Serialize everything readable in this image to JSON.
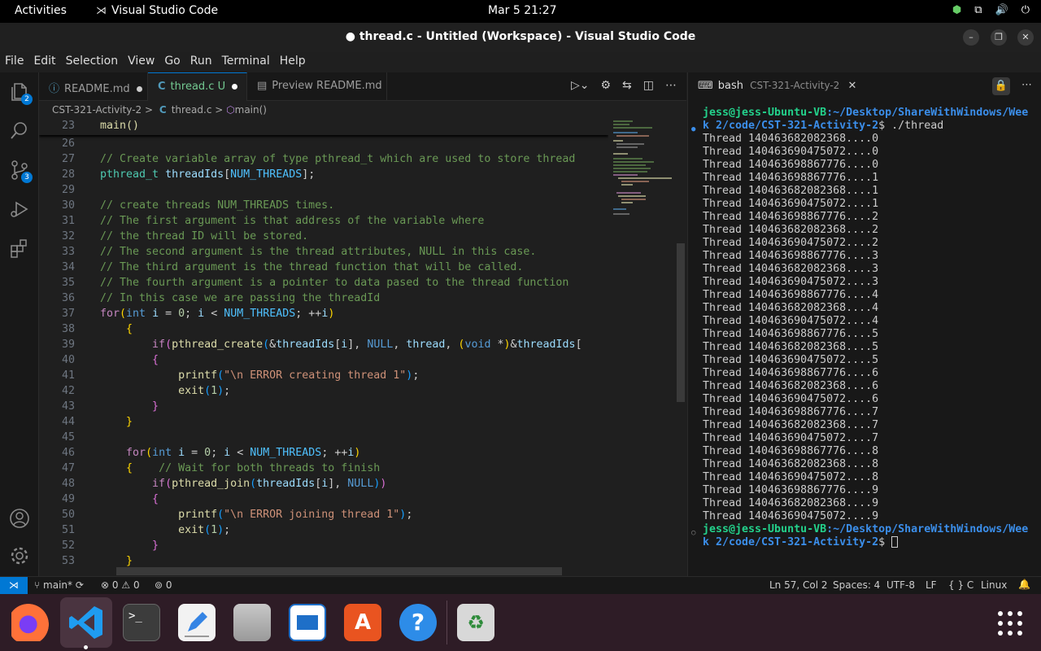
{
  "topbar": {
    "activities": "Activities",
    "app_name": "Visual Studio Code",
    "clock": "Mar 5  21:27"
  },
  "window": {
    "title": "● thread.c - Untitled (Workspace) - Visual Studio Code",
    "min": "–",
    "max": "❐",
    "close": "✕"
  },
  "menu": [
    "File",
    "Edit",
    "Selection",
    "View",
    "Go",
    "Run",
    "Terminal",
    "Help"
  ],
  "activity": {
    "explorer_badge": "2",
    "scm_badge": "3"
  },
  "tabs": [
    {
      "label": "README.md",
      "icon": "ⓘ"
    },
    {
      "label": "thread.c",
      "icon": "C",
      "status": "U"
    },
    {
      "label": "Preview README.md",
      "icon": "▤"
    }
  ],
  "breadcrumb": {
    "folder": "CST-321-Activity-2",
    "sep": ">",
    "file": "thread.c",
    "symbol": "main()",
    "c_icon": "C",
    "sym_icon": "⬡"
  },
  "code": {
    "sticky": {
      "num": "23",
      "text": "main()"
    },
    "lines": [
      {
        "num": "26",
        "html": ""
      },
      {
        "num": "27",
        "html": "<span class='cm'>// Create variable array of type pthread_t which are used to store thread</span>"
      },
      {
        "num": "28",
        "html": "<span class='ty'>pthread_t</span> <span class='vr'>threadIds</span>[<span class='mc'>NUM_THREADS</span>];"
      },
      {
        "num": "29",
        "html": ""
      },
      {
        "num": "30",
        "html": "<span class='cm'>// create threads NUM_THREADS times.</span>"
      },
      {
        "num": "31",
        "html": "<span class='cm'>// The first argument is that address of the variable where</span>"
      },
      {
        "num": "32",
        "html": "<span class='cm'>// the thread ID will be stored.</span>"
      },
      {
        "num": "33",
        "html": "<span class='cm'>// The second argument is the thread attributes, NULL in this case.</span>"
      },
      {
        "num": "34",
        "html": "<span class='cm'>// The third argument is the thread function that will be called.</span>"
      },
      {
        "num": "35",
        "html": "<span class='cm'>// The fourth argument is a pointer to data pased to the thread function</span>"
      },
      {
        "num": "36",
        "html": "<span class='cm'>// In this case we are passing the threadId</span>"
      },
      {
        "num": "37",
        "html": "<span class='ctl'>for</span><span class='br1'>(</span><span class='kw'>int</span> <span class='vr'>i</span> = <span class='nm'>0</span>; <span class='vr'>i</span> &lt; <span class='mc'>NUM_THREADS</span>; ++<span class='vr'>i</span><span class='br1'>)</span>"
      },
      {
        "num": "38",
        "html": "    <span class='br1'>{</span>"
      },
      {
        "num": "39",
        "html": "        <span class='ctl'>if</span><span class='br2'>(</span><span class='fn'>pthread_create</span><span class='br3'>(</span>&amp;<span class='vr'>threadIds</span>[<span class='vr'>i</span>], <span class='kw'>NULL</span>, <span class='vr'>thread</span>, <span class='br1'>(</span><span class='kw'>void</span> *<span class='br1'>)</span>&amp;<span class='vr'>threadIds</span>["
      },
      {
        "num": "40",
        "html": "        <span class='br2'>{</span>"
      },
      {
        "num": "41",
        "html": "            <span class='fn'>printf</span><span class='br3'>(</span><span class='st'>\"\\n ERROR creating thread 1\"</span><span class='br3'>)</span>;"
      },
      {
        "num": "42",
        "html": "            <span class='fn'>exit</span><span class='br3'>(</span><span class='nm'>1</span><span class='br3'>)</span>;"
      },
      {
        "num": "43",
        "html": "        <span class='br2'>}</span>"
      },
      {
        "num": "44",
        "html": "    <span class='br1'>}</span>"
      },
      {
        "num": "45",
        "html": ""
      },
      {
        "num": "46",
        "html": "    <span class='ctl'>for</span><span class='br1'>(</span><span class='kw'>int</span> <span class='vr'>i</span> = <span class='nm'>0</span>; <span class='vr'>i</span> &lt; <span class='mc'>NUM_THREADS</span>; ++<span class='vr'>i</span><span class='br1'>)</span>"
      },
      {
        "num": "47",
        "html": "    <span class='br1'>{</span>    <span class='cm'>// Wait for both threads to finish</span>"
      },
      {
        "num": "48",
        "html": "        <span class='ctl'>if</span><span class='br2'>(</span><span class='fn'>pthread_join</span><span class='br3'>(</span><span class='vr'>threadIds</span>[<span class='vr'>i</span>], <span class='kw'>NULL</span><span class='br3'>)</span><span class='br2'>)</span>"
      },
      {
        "num": "49",
        "html": "        <span class='br2'>{</span>"
      },
      {
        "num": "50",
        "html": "            <span class='fn'>printf</span><span class='br3'>(</span><span class='st'>\"\\n ERROR joining thread 1\"</span><span class='br3'>)</span>;"
      },
      {
        "num": "51",
        "html": "            <span class='fn'>exit</span><span class='br3'>(</span><span class='nm'>1</span><span class='br3'>)</span>;"
      },
      {
        "num": "52",
        "html": "        <span class='br2'>}</span>"
      },
      {
        "num": "53",
        "html": "    <span class='br1'>}</span>"
      }
    ]
  },
  "terminal": {
    "tab_label": "bash",
    "tab_cwd": "CST-321-Activity-2",
    "prompt_user": "jess@jess-Ubuntu-VB",
    "prompt_path_1": ":~/Desktop/ShareWithWindows/Wee",
    "prompt_path_2": "k 2/code/CST-321-Activity-2",
    "command": "$ ./thread",
    "prompt_end": "$ ",
    "output": [
      "Thread 140463682082368....0",
      "Thread 140463690475072....0",
      "Thread 140463698867776....0",
      "Thread 140463698867776....1",
      "Thread 140463682082368....1",
      "Thread 140463690475072....1",
      "Thread 140463698867776....2",
      "Thread 140463682082368....2",
      "Thread 140463690475072....2",
      "Thread 140463698867776....3",
      "Thread 140463682082368....3",
      "Thread 140463690475072....3",
      "Thread 140463698867776....4",
      "Thread 140463682082368....4",
      "Thread 140463690475072....4",
      "Thread 140463698867776....5",
      "Thread 140463682082368....5",
      "Thread 140463690475072....5",
      "Thread 140463698867776....6",
      "Thread 140463682082368....6",
      "Thread 140463690475072....6",
      "Thread 140463698867776....7",
      "Thread 140463682082368....7",
      "Thread 140463690475072....7",
      "Thread 140463698867776....8",
      "Thread 140463682082368....8",
      "Thread 140463690475072....8",
      "Thread 140463698867776....9",
      "Thread 140463682082368....9",
      "Thread 140463690475072....9"
    ]
  },
  "status": {
    "remote": "⋊",
    "branch": "main*",
    "errors": "0",
    "warnings": "0",
    "ports": "0",
    "position": "Ln 57, Col 2",
    "spaces": "Spaces: 4",
    "encoding": "UTF-8",
    "eol": "LF",
    "lang_braces": "{ }",
    "language": "C",
    "platform": "Linux"
  },
  "dock": [
    {
      "name": "Firefox",
      "icon": "firefox-icon"
    },
    {
      "name": "Visual Studio Code",
      "icon": "vscode-icon"
    },
    {
      "name": "Terminal",
      "icon": "terminal-icon",
      "glyph": ">_"
    },
    {
      "name": "Text Editor",
      "icon": "text-editor-icon"
    },
    {
      "name": "Files",
      "icon": "files-icon"
    },
    {
      "name": "LibreOffice Writer",
      "icon": "writer-icon"
    },
    {
      "name": "Ubuntu Software",
      "icon": "software-icon",
      "glyph": "A"
    },
    {
      "name": "Help",
      "icon": "help-icon",
      "glyph": "?"
    },
    {
      "name": "Trash",
      "icon": "trash-icon",
      "glyph": "♻"
    }
  ],
  "colors": {
    "accent": "#0078d4",
    "comment": "#6a9955",
    "keyword": "#569cd6",
    "prompt_user": "#23d18b",
    "prompt_path": "#3b8eea"
  }
}
